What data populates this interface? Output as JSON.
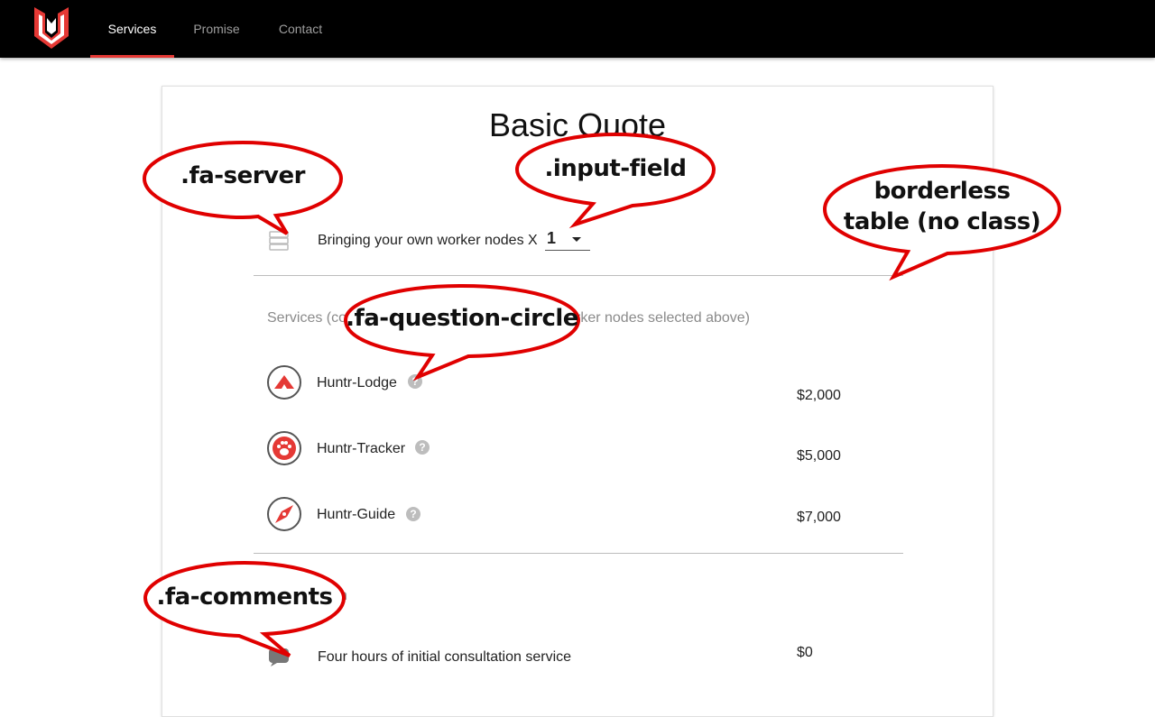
{
  "nav": {
    "items": [
      {
        "label": "Services",
        "active": true
      },
      {
        "label": "Promise",
        "active": false
      },
      {
        "label": "Contact",
        "active": false
      }
    ]
  },
  "quote": {
    "title": "Basic Quote",
    "worker_nodes_label": "Bringing your own worker nodes X",
    "worker_nodes_value": "1",
    "services_heading_visible_start": "Services (co",
    "services_heading_visible_end": "rker nodes selected above)",
    "services": [
      {
        "name": "Huntr-Lodge",
        "price": "$2,000",
        "icon": "lodge-icon"
      },
      {
        "name": "Huntr-Tracker",
        "price": "$5,000",
        "icon": "paw-icon"
      },
      {
        "name": "Huntr-Guide",
        "price": "$7,000",
        "icon": "compass-icon"
      }
    ],
    "consultation_heading_visible": "n",
    "consultation": {
      "label": "Four hours of initial consultation service",
      "price": "$0"
    }
  },
  "callouts": {
    "fa_server": ".fa-server",
    "input_field": ".input-field",
    "borderless_line1": "borderless",
    "borderless_line2": "table (no class)",
    "fa_question_circle": ".fa-question-circle",
    "fa_comments": ".fa-comments"
  },
  "colors": {
    "accent": "#e53935",
    "navbar": "#000000",
    "callout_border": "#e00000"
  }
}
